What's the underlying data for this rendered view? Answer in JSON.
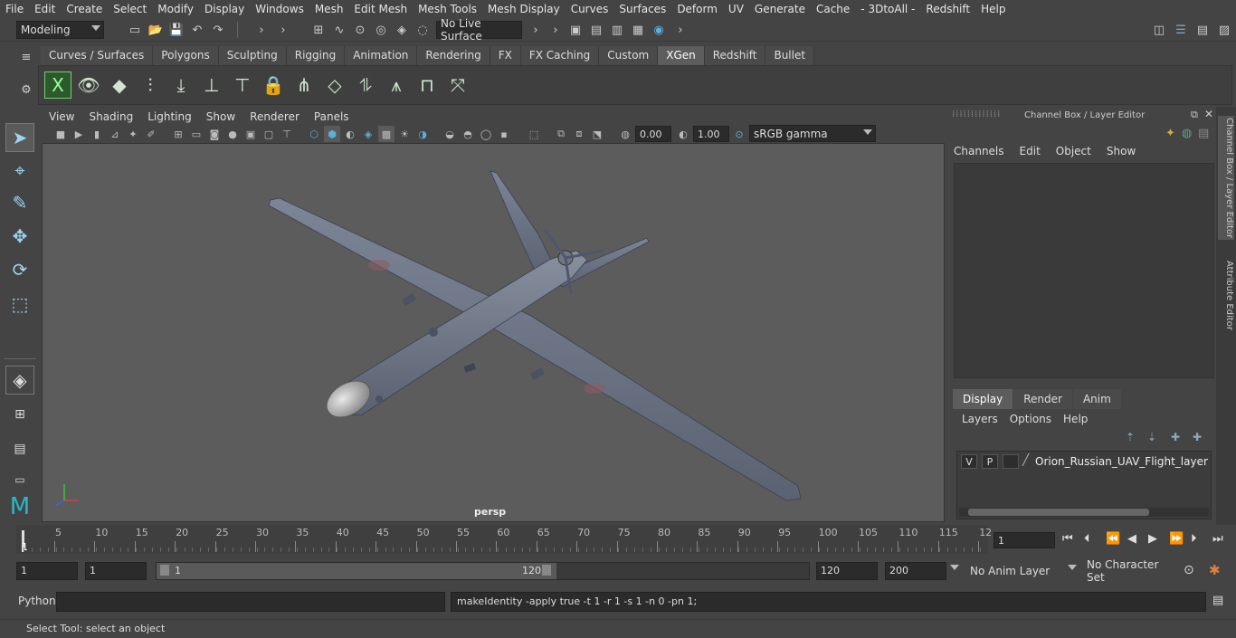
{
  "menubar": {
    "items": [
      "File",
      "Edit",
      "Create",
      "Select",
      "Modify",
      "Display",
      "Windows",
      "Mesh",
      "Edit Mesh",
      "Mesh Tools",
      "Mesh Display",
      "Curves",
      "Surfaces",
      "Deform",
      "UV",
      "Generate",
      "Cache",
      "- 3DtoAll -",
      "Redshift",
      "Help"
    ]
  },
  "statusline": {
    "workspace": "Modeling",
    "live_surface": "No Live Surface"
  },
  "shelf": {
    "tabs": [
      "Curves / Surfaces",
      "Polygons",
      "Sculpting",
      "Rigging",
      "Animation",
      "Rendering",
      "FX",
      "FX Caching",
      "Custom",
      "XGen",
      "Redshift",
      "Bullet"
    ],
    "active_tab": "XGen"
  },
  "panel": {
    "menu": [
      "View",
      "Shading",
      "Lighting",
      "Show",
      "Renderer",
      "Panels"
    ],
    "exposure": "0.00",
    "gamma": "1.00",
    "color_space": "sRGB gamma",
    "camera_label": "persp"
  },
  "channel_box": {
    "header": "Channel Box / Layer Editor",
    "menu": [
      "Channels",
      "Edit",
      "Object",
      "Show"
    ]
  },
  "layer_editor": {
    "tabs": [
      "Display",
      "Render",
      "Anim"
    ],
    "active_tab": "Display",
    "menu": [
      "Layers",
      "Options",
      "Help"
    ],
    "layers": [
      {
        "v": "V",
        "p": "P",
        "name": "Orion_Russian_UAV_Flight_layer"
      }
    ]
  },
  "side_tabs": [
    "Channel Box / Layer Editor",
    "Attribute Editor"
  ],
  "timeline": {
    "ticks": [
      "5",
      "10",
      "15",
      "20",
      "25",
      "30",
      "35",
      "40",
      "45",
      "50",
      "55",
      "60",
      "65",
      "70",
      "75",
      "80",
      "85",
      "90",
      "95",
      "100",
      "105",
      "110",
      "115",
      "12"
    ],
    "start_marker": "1",
    "current_frame": "1"
  },
  "range": {
    "start": "1",
    "start_inner": "1",
    "slider_start": "1",
    "slider_end": "120",
    "end_inner": "120",
    "end": "200",
    "anim_layer": "No Anim Layer",
    "character_set": "No Character Set"
  },
  "cmdline": {
    "lang": "Python",
    "output": "makeIdentity -apply true -t 1 -r 1 -s 1 -n 0 -pn 1;"
  },
  "helpline": {
    "text": "Select Tool: select an object"
  },
  "colors": {
    "bg": "#444444",
    "viewport": "#5c5c5c",
    "accent": "#5285a6",
    "drone": "#6e7687"
  }
}
